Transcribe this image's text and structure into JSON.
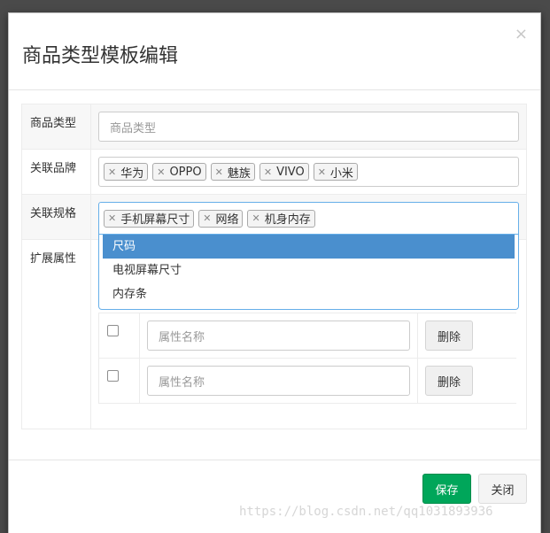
{
  "modal": {
    "title": "商品类型模板编辑",
    "close_symbol": "×"
  },
  "form": {
    "type_label": "商品类型",
    "type_placeholder": "商品类型",
    "brand_label": "关联品牌",
    "brand_tags": [
      "华为",
      "OPPO",
      "魅族",
      "VIVO",
      "小米"
    ],
    "spec_label": "关联规格",
    "spec_tags": [
      "手机屏幕尺寸",
      "网络",
      "机身内存"
    ],
    "attr_label": "扩展属性"
  },
  "dropdown": {
    "options": [
      "尺码",
      "电视屏幕尺寸",
      "内存条"
    ],
    "active_index": 0
  },
  "attributes": {
    "rows": [
      {
        "placeholder": "属性名称",
        "delete_label": "删除"
      },
      {
        "placeholder": "属性名称",
        "delete_label": "删除"
      }
    ]
  },
  "footer": {
    "save_label": "保存",
    "close_label": "关闭"
  },
  "watermark": "https://blog.csdn.net/qq1031893936",
  "colors": {
    "save": "#00a65a",
    "dropdown_active": "#4a8fce",
    "focus_border": "#66afe9"
  }
}
